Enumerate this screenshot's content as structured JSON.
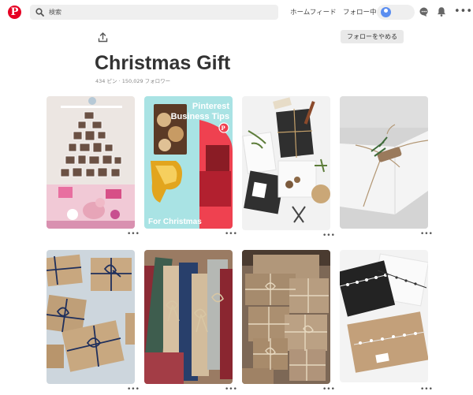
{
  "header": {
    "logo": "P",
    "search_placeholder": "検索",
    "home_label": "ホームフィード",
    "following_label": "フォロー中",
    "more_label": "•••"
  },
  "board": {
    "share_icon": "share-icon",
    "follow_button": "フォローをやめる",
    "title": "Christmas Gift",
    "pins_count": "434 ピン",
    "separator": "·",
    "followers_count": "150,029 フォロワー"
  },
  "pins": [
    {
      "name": "christmas-tree-photo-wall",
      "more": "•••"
    },
    {
      "name": "pinterest-business-tips",
      "overlay_title": "Pinterest\nBusiness Tips",
      "overlay_caption": "For Christmas",
      "more": "•••"
    },
    {
      "name": "gift-wrapping-flatlay",
      "more": "•••"
    },
    {
      "name": "white-box-twine",
      "more": "•••"
    },
    {
      "name": "kraft-boxes-navy-ribbon",
      "more": "•••"
    },
    {
      "name": "fabric-rolls",
      "more": "•••"
    },
    {
      "name": "kraft-gift-pile",
      "more": "•••"
    },
    {
      "name": "star-ribbon-gifts",
      "more": "•••"
    }
  ]
}
